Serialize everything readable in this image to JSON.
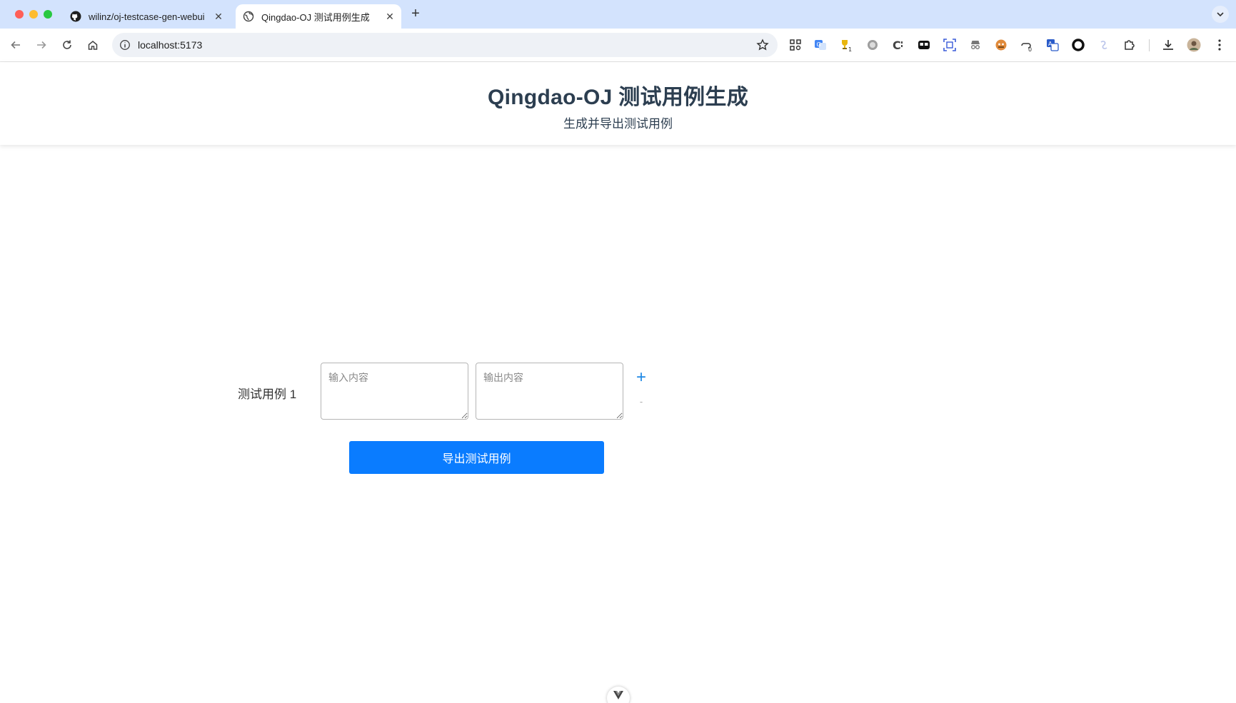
{
  "browser": {
    "tabs": [
      {
        "title": "wilinz/oj-testcase-gen-webui",
        "icon": "github-icon"
      },
      {
        "title": "Qingdao-OJ 测试用例生成",
        "icon": "globe-icon",
        "active": true
      }
    ],
    "url": "localhost:5173",
    "extension_badges": {
      "trophy": "1",
      "cloud": "0"
    }
  },
  "header": {
    "title": "Qingdao-OJ 测试用例生成",
    "subtitle": "生成并导出测试用例"
  },
  "form": {
    "cases": [
      {
        "label": "测试用例 1",
        "input_placeholder": "输入内容",
        "output_placeholder": "输出内容",
        "input_value": "",
        "output_value": ""
      }
    ],
    "add_label": "+",
    "remove_label": "-",
    "export_label": "导出测试用例"
  },
  "colors": {
    "primary": "#0a7cff",
    "tabbar": "#d3e3fd",
    "text": "#2c3e50"
  }
}
